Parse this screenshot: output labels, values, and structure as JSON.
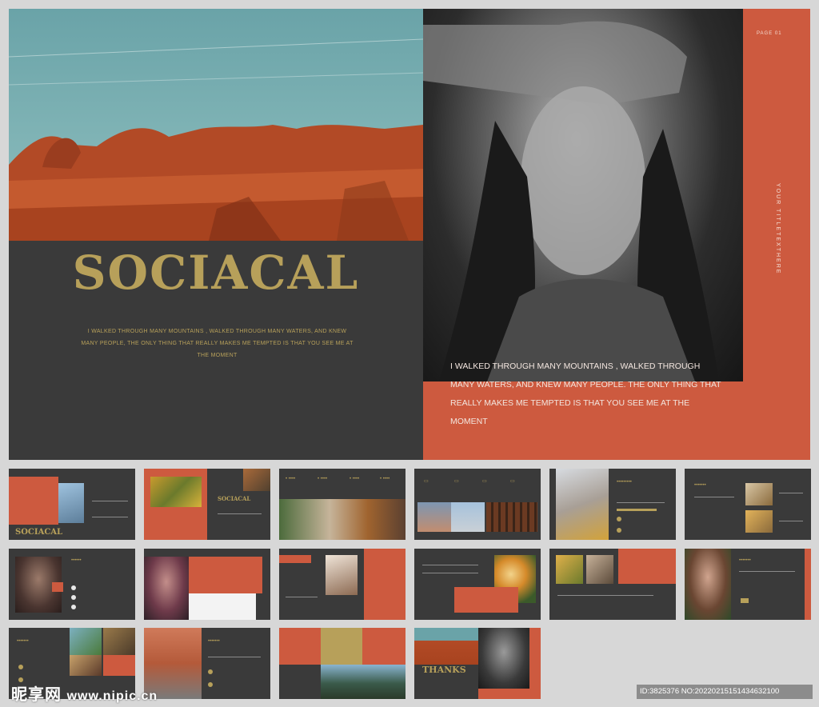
{
  "hero": {
    "title": "SOCIACAL",
    "body": "I WALKED THROUGH MANY MOUNTAINS , WALKED THROUGH MANY WATERS, AND KNEW MANY PEOPLE, THE ONLY THING THAT REALLY MAKES ME TEMPTED IS THAT YOU SEE ME AT THE MOMENT",
    "page_label": "PAGE 01",
    "vertical_title": "YOUR TITLETEXTHERE",
    "quote": "I WALKED THROUGH MANY MOUNTAINS , WALKED THROUGH MANY WATERS, AND KNEW MANY PEOPLE. THE ONLY THING THAT REALLY MAKES ME TEMPTED IS THAT YOU SEE ME AT THE MOMENT"
  },
  "thumbnails": {
    "t1_title": "SOCIACAL",
    "t2_title": "SOCIACAL",
    "t16_title": "THANKS"
  },
  "watermark": {
    "brand": "昵享网",
    "url": "www.nipic.cn",
    "id_text": "ID:3825376 NO:20220215151434632100"
  },
  "colors": {
    "accent_orange": "#cd5a3f",
    "accent_gold": "#b7a05a",
    "background_dark": "#3a3a3a"
  }
}
